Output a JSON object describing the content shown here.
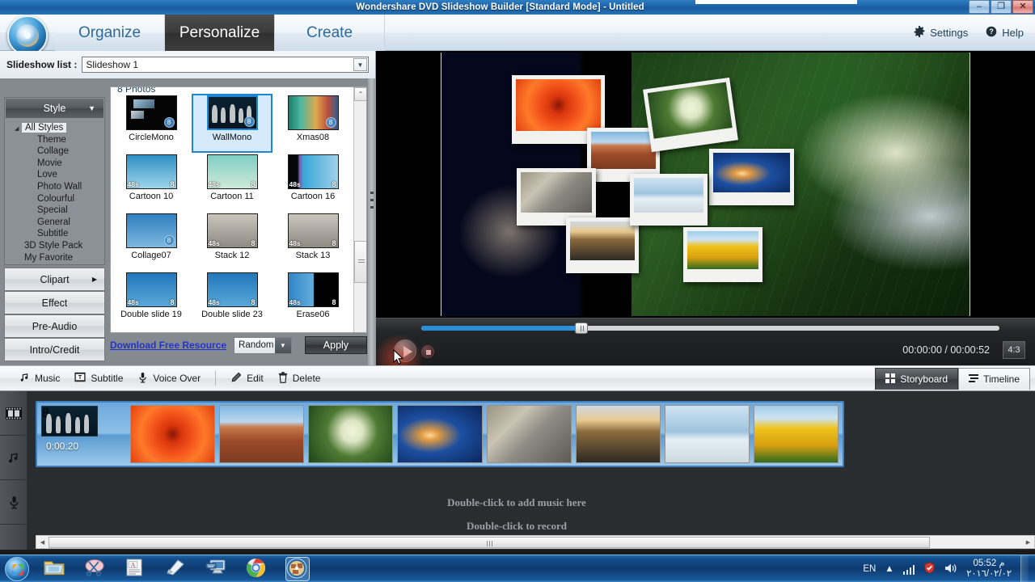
{
  "window": {
    "title": "Wondershare DVD Slideshow Builder [Standard Mode] - Untitled",
    "minimize": "–",
    "maximize": "❐",
    "close": "✕"
  },
  "ribbon": {
    "tabs": [
      {
        "label": "Organize",
        "active": false
      },
      {
        "label": "Personalize",
        "active": true
      },
      {
        "label": "Create",
        "active": false
      }
    ],
    "settings_label": "Settings",
    "help_label": "Help",
    "settings_icon": "gear-icon",
    "help_icon": "question-circle-icon"
  },
  "slideshow_list": {
    "label": "Slideshow list :",
    "value": "Slideshow 1",
    "arrow": "▼"
  },
  "style_panel": {
    "header": "Style",
    "header_caret": "▼",
    "tree": [
      {
        "label": "All Styles",
        "level": 0,
        "selected": true,
        "expander": "◢"
      },
      {
        "label": "Theme",
        "level": 2,
        "selected": false
      },
      {
        "label": "Collage",
        "level": 2,
        "selected": false
      },
      {
        "label": "Movie",
        "level": 2,
        "selected": false
      },
      {
        "label": "Love",
        "level": 2,
        "selected": false
      },
      {
        "label": "Photo Wall",
        "level": 2,
        "selected": false
      },
      {
        "label": "Colourful",
        "level": 2,
        "selected": false
      },
      {
        "label": "Special",
        "level": 2,
        "selected": false
      },
      {
        "label": "General",
        "level": 2,
        "selected": false
      },
      {
        "label": "Subtitle",
        "level": 2,
        "selected": false
      },
      {
        "label": "3D Style Pack",
        "level": 1,
        "selected": false
      },
      {
        "label": "My Favorite",
        "level": 1,
        "selected": false
      }
    ],
    "buttons": [
      {
        "label": "Clipart",
        "caret": "▶"
      },
      {
        "label": "Effect",
        "caret": ""
      },
      {
        "label": "Pre-Audio",
        "caret": ""
      },
      {
        "label": "Intro/Credit",
        "caret": ""
      }
    ]
  },
  "style_grid": {
    "photos_count": "8 Photos",
    "items": [
      {
        "name": "CircleMono",
        "badge": "8",
        "duration": "",
        "selected": false,
        "art": "art-circlemono"
      },
      {
        "name": "WallMono",
        "badge": "8",
        "duration": "",
        "selected": true,
        "art": "art-wallmono"
      },
      {
        "name": "Xmas08",
        "badge": "8",
        "duration": "",
        "selected": false,
        "art": "art-xmas"
      },
      {
        "name": "Cartoon 10",
        "badge": "8",
        "duration": "48s",
        "selected": false,
        "art": "art-cart"
      },
      {
        "name": "Cartoon 11",
        "badge": "8",
        "duration": "48s",
        "selected": false,
        "art": "art-cart2"
      },
      {
        "name": "Cartoon 16",
        "badge": "8",
        "duration": "48s",
        "selected": false,
        "art": "art-cart3"
      },
      {
        "name": "Collage07",
        "badge": "8",
        "duration": "",
        "selected": false,
        "art": "art-collage"
      },
      {
        "name": "Stack 12",
        "badge": "8",
        "duration": "48s",
        "selected": false,
        "art": "art-stack"
      },
      {
        "name": "Stack 13",
        "badge": "8",
        "duration": "48s",
        "selected": false,
        "art": "art-stack"
      },
      {
        "name": "Double slide 19",
        "badge": "8",
        "duration": "48s",
        "selected": false,
        "art": "art-dbl"
      },
      {
        "name": "Double slide 23",
        "badge": "8",
        "duration": "48s",
        "selected": false,
        "art": "art-dbl"
      },
      {
        "name": "Erase06",
        "badge": "8",
        "duration": "48s",
        "selected": false,
        "art": "art-erase"
      }
    ],
    "scroll_up": "⌃",
    "scroll_down": "⌄"
  },
  "style_actions": {
    "download_link": "Download Free Resource",
    "transition_value": "Random",
    "transition_caret": "▼",
    "apply_label": "Apply"
  },
  "preview": {
    "photos": [
      {
        "name": "red-flower"
      },
      {
        "name": "canyon"
      },
      {
        "name": "hydrangea"
      },
      {
        "name": "jellyfish"
      },
      {
        "name": "koala"
      },
      {
        "name": "castle"
      },
      {
        "name": "penguins"
      },
      {
        "name": "tulips"
      }
    ]
  },
  "player": {
    "play_icon": "play-icon",
    "stop_icon": "stop-icon",
    "current_time": "00:00:00",
    "total_time": "00:00:52",
    "timecode": "00:00:00 / 00:00:52",
    "aspect_ratio": "4:3",
    "progress_percent": 28
  },
  "toolstrip": {
    "buttons": [
      {
        "label": "Music",
        "icon": "music-note-icon"
      },
      {
        "label": "Subtitle",
        "icon": "subtitle-icon"
      },
      {
        "label": "Voice Over",
        "icon": "microphone-icon"
      },
      {
        "label": "Edit",
        "icon": "pencil-icon"
      },
      {
        "label": "Delete",
        "icon": "trash-icon"
      }
    ],
    "view_tabs": [
      {
        "label": "Storyboard",
        "icon": "grid-icon",
        "active": true
      },
      {
        "label": "Timeline",
        "icon": "timeline-icon",
        "active": false
      }
    ]
  },
  "storyboard": {
    "rail_icons": [
      "film-strip-icon",
      "music-note-icon",
      "microphone-icon"
    ],
    "first_cell_time": "0:00:20",
    "first_cell_badge": "8",
    "clips": [
      {
        "name": "style-clip",
        "art": "sb-style"
      },
      {
        "name": "red-flower",
        "art": "ph-flower"
      },
      {
        "name": "canyon",
        "art": "ph-canyon"
      },
      {
        "name": "hydrangea",
        "art": "ph-hydr"
      },
      {
        "name": "jellyfish",
        "art": "ph-jelly"
      },
      {
        "name": "koala",
        "art": "ph-koala"
      },
      {
        "name": "castle",
        "art": "ph-castle"
      },
      {
        "name": "penguins",
        "art": "ph-peng"
      },
      {
        "name": "tulips",
        "art": "ph-tulip"
      }
    ],
    "music_hint": "Double-click to add music here",
    "record_hint": "Double-click to record"
  },
  "taskbar": {
    "start_icon": "windows-orb-icon",
    "apps": [
      {
        "name": "file-explorer-icon",
        "active": false
      },
      {
        "name": "snipping-tool-icon",
        "active": false
      },
      {
        "name": "word-document-icon",
        "active": false
      },
      {
        "name": "notepad-icon",
        "active": false
      },
      {
        "name": "remote-desktop-icon",
        "active": false
      },
      {
        "name": "chrome-icon",
        "active": false
      },
      {
        "name": "dvd-slideshow-builder-icon",
        "active": true
      }
    ],
    "language": "EN",
    "tray_icons": [
      "show-hidden-icons",
      "network-icon",
      "antivirus-icon",
      "volume-icon"
    ],
    "time": "05:52 م",
    "date": "٢٠١٦/٠٢/٠٢"
  }
}
